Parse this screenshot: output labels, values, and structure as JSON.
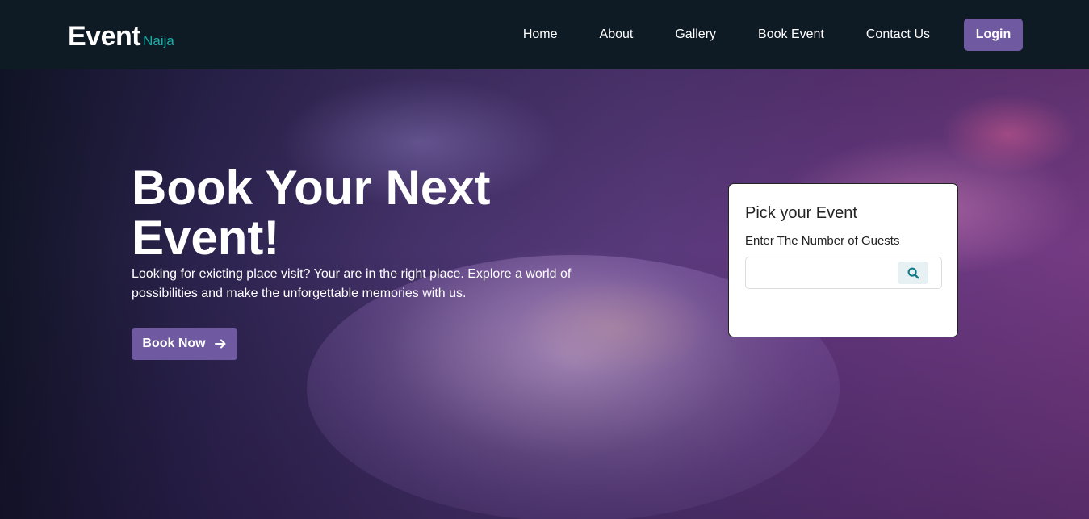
{
  "brand": {
    "name": "Event",
    "sub": "Naija"
  },
  "nav": {
    "links": [
      "Home",
      "About",
      "Gallery",
      "Book Event",
      "Contact Us"
    ],
    "login_label": "Login"
  },
  "hero": {
    "title": "Book Your Next Event!",
    "description": "Looking for exicting place visit? Your are in the right place. Explore a world of possibilities and make the unforgettable memories with us.",
    "book_label": "Book Now",
    "book_icon": "arrow-right-icon"
  },
  "card": {
    "title": "Pick your Event",
    "label": "Enter The Number of Guests",
    "input_value": "",
    "search_icon": "search-icon"
  },
  "colors": {
    "accent": "#6f5aa1",
    "brand_sub": "#18b0a6",
    "navbar": "#0e1a24"
  }
}
